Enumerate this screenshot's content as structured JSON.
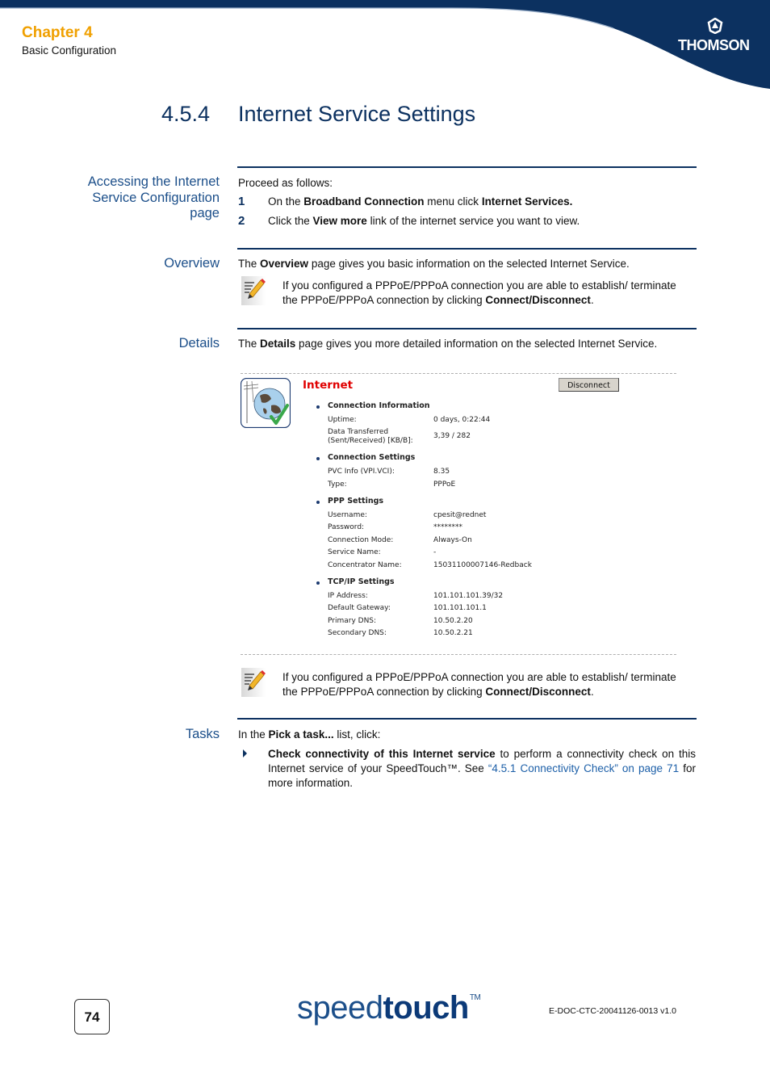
{
  "header": {
    "chapter": "Chapter 4",
    "subchapter": "Basic Configuration",
    "brand": "THOMSON"
  },
  "section": {
    "number": "4.5.4",
    "title": "Internet Service Settings"
  },
  "accessing": {
    "side_heading_lines": [
      "Accessing the Internet",
      "Service Configuration",
      "page"
    ],
    "intro": "Proceed as follows:",
    "steps": [
      {
        "n": "1",
        "parts": [
          "On the ",
          "Broadband Connection",
          " menu click ",
          "Internet Services."
        ]
      },
      {
        "n": "2",
        "parts": [
          "Click the ",
          "View more",
          " link of the internet service you want to view."
        ]
      }
    ]
  },
  "overview": {
    "side_heading": "Overview",
    "text_parts": [
      "The ",
      "Overview",
      " page gives you basic information on the selected Internet Service."
    ],
    "note_parts": [
      "If you configured a PPPoE/PPPoA connection you are able to establish/ terminate the PPPoE/PPPoA connection by clicking ",
      "Connect/Disconnect",
      "."
    ]
  },
  "details": {
    "side_heading": "Details",
    "text_parts": [
      "The ",
      "Details",
      " page gives you more detailed information on the selected Internet Service."
    ],
    "note_parts": [
      "If you configured a PPPoE/PPPoA connection you are able to establish/ terminate the PPPoE/PPPoA connection by clicking ",
      "Connect/Disconnect",
      "."
    ],
    "screenshot": {
      "title": "Internet",
      "button": "Disconnect",
      "groups": [
        {
          "name": "Connection Information",
          "rows": [
            {
              "label": "Uptime:",
              "value": "0 days, 0:22:44"
            },
            {
              "label": "Data Transferred (Sent/Received) [KB/B]:",
              "label_lines": [
                "Data Transferred",
                "(Sent/Received) [KB/B]:"
              ],
              "value": "3,39 / 282"
            }
          ]
        },
        {
          "name": "Connection Settings",
          "rows": [
            {
              "label": "PVC Info (VPI.VCI):",
              "value": "8.35"
            },
            {
              "label": "Type:",
              "value": "PPPoE"
            }
          ]
        },
        {
          "name": "PPP Settings",
          "rows": [
            {
              "label": "Username:",
              "value": "cpesit@rednet"
            },
            {
              "label": "Password:",
              "value": "********"
            },
            {
              "label": "Connection Mode:",
              "value": "Always-On"
            },
            {
              "label": "Service Name:",
              "value": "-"
            },
            {
              "label": "Concentrator Name:",
              "value": "15031100007146-Redback"
            }
          ]
        },
        {
          "name": "TCP/IP Settings",
          "rows": [
            {
              "label": "IP Address:",
              "value": "101.101.101.39/32"
            },
            {
              "label": "Default Gateway:",
              "value": "101.101.101.1"
            },
            {
              "label": "Primary DNS:",
              "value": "10.50.2.20"
            },
            {
              "label": "Secondary DNS:",
              "value": "10.50.2.21"
            }
          ]
        }
      ]
    }
  },
  "tasks": {
    "side_heading": "Tasks",
    "intro_parts": [
      "In the ",
      "Pick a task...",
      " list, click:"
    ],
    "item": {
      "bold": "Check connectivity of this Internet service",
      "text": " to perform a connectivity check on this Internet service of your SpeedTouch™. See ",
      "link": "“4.5.1 Connectivity Check” on page 71",
      "tail": " for more information."
    }
  },
  "footer": {
    "page_number": "74",
    "logo_light": "speed",
    "logo_bold": "touch",
    "logo_tm": "TM",
    "doc_id": "E-DOC-CTC-20041126-0013 v1.0"
  }
}
